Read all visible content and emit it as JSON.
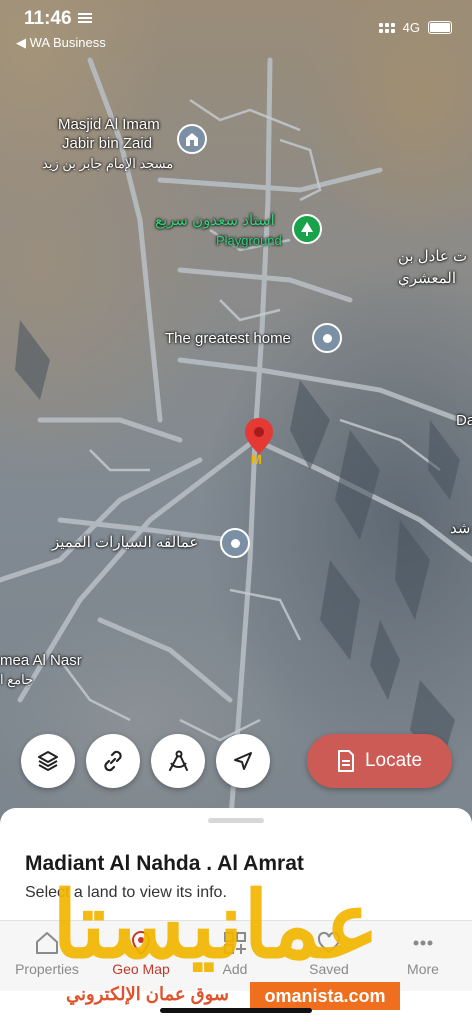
{
  "status_bar": {
    "time": "11:46",
    "back_app": "◀ WA Business",
    "network": "4G"
  },
  "map": {
    "labels": [
      {
        "id": "masjid-en-1",
        "text": "Masjid Al Imam"
      },
      {
        "id": "masjid-en-2",
        "text": "Jabir bin Zaid"
      },
      {
        "id": "masjid-ar",
        "text": "مسجد الإمام جابر بن زيد"
      },
      {
        "id": "stadium-ar",
        "text": "استاد سعدون سريع"
      },
      {
        "id": "stadium-en",
        "text": "Playground"
      },
      {
        "id": "adil-ar-1",
        "text": "ت عادل بن"
      },
      {
        "id": "adil-ar-2",
        "text": "المعشري"
      },
      {
        "id": "greatest-home",
        "text": "The greatest home"
      },
      {
        "id": "cars-ar",
        "text": "عمالقه السيارات المميز"
      },
      {
        "id": "jamea-en",
        "text": "mea Al Nasr"
      },
      {
        "id": "jamea-ar",
        "text": "جامع ا"
      },
      {
        "id": "edge-da",
        "text": "Da"
      },
      {
        "id": "edge-shd",
        "text": "شد"
      }
    ],
    "pin_letter": "M"
  },
  "controls": {
    "layers_icon": "layers-icon",
    "link_icon": "link-icon",
    "measure_icon": "measure-icon",
    "navigate_icon": "navigation-arrow-icon",
    "locate_label": "Locate",
    "locate_color": "#cc5a55"
  },
  "sheet": {
    "title": "Madiant Al Nahda . Al Amrat",
    "subtitle": "Select a land to view its info."
  },
  "tabs": [
    {
      "label": "Properties",
      "icon": "home-icon"
    },
    {
      "label": "Geo Map",
      "icon": "map-pin-icon",
      "active": true
    },
    {
      "label": "Add",
      "icon": "add-grid-icon"
    },
    {
      "label": "Saved",
      "icon": "heart-icon"
    },
    {
      "label": "More",
      "icon": "more-dots-icon"
    }
  ],
  "watermark": {
    "brand_ar": "عمانيستا",
    "tagline_ar": "سوق عمان الإلكتروني",
    "site": "omanista.com",
    "brand_color": "#f2b600",
    "accent_color": "#f06f1f"
  }
}
